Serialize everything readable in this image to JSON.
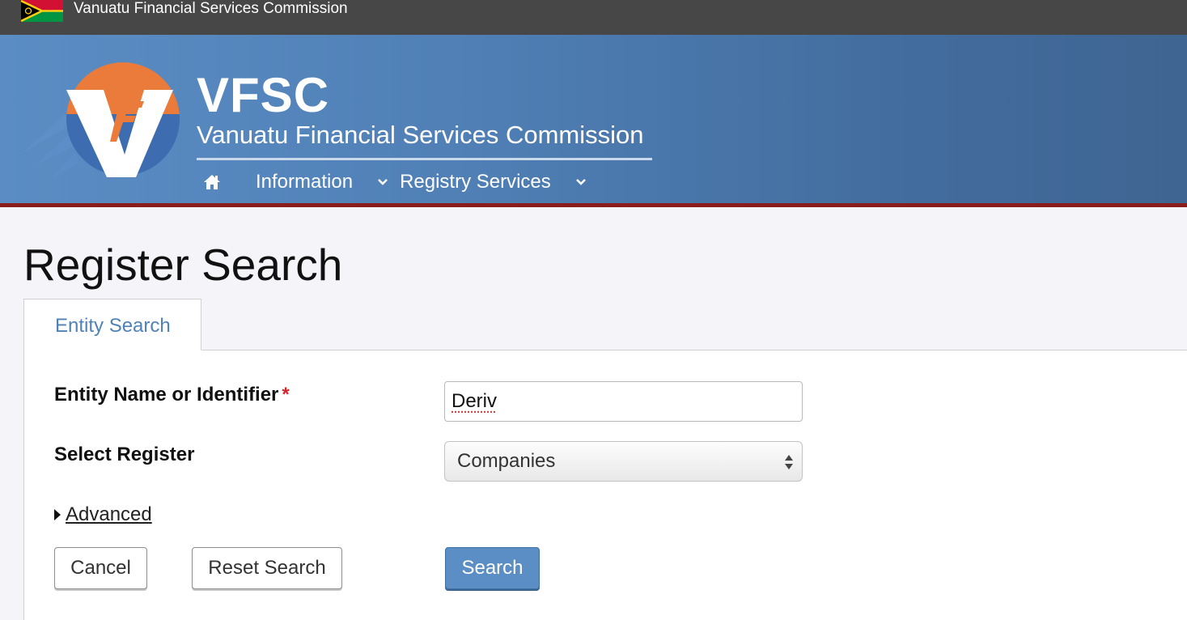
{
  "topbar": {
    "title": "Vanuatu Financial Services Commission"
  },
  "banner": {
    "abbr": "VFSC",
    "name": "Vanuatu Financial Services Commission"
  },
  "nav": {
    "items": [
      {
        "label": "Information"
      },
      {
        "label": "Registry Services"
      }
    ]
  },
  "page": {
    "title": "Register Search"
  },
  "tabs": [
    {
      "label": "Entity Search",
      "active": true
    }
  ],
  "form": {
    "entity_label": "Entity Name or Identifier",
    "required_mark": "*",
    "entity_value": "Deriv",
    "register_label": "Select Register",
    "register_selected": "Companies",
    "advanced_label": "Advanced"
  },
  "buttons": {
    "cancel": "Cancel",
    "reset": "Reset Search",
    "search": "Search"
  },
  "colors": {
    "accent": "#5b8ec4",
    "banner": "#4f7fb5",
    "banner_rule": "#8a1c1c",
    "required": "#d0262b",
    "tab_text": "#4f82b6"
  },
  "icons": {
    "home": "home-icon",
    "flag": "vanuatu-flag-icon",
    "logo": "vfsc-logo",
    "dropdown": "chevron-down-icon",
    "select": "select-arrows-icon",
    "disclosure": "caret-right-icon"
  }
}
